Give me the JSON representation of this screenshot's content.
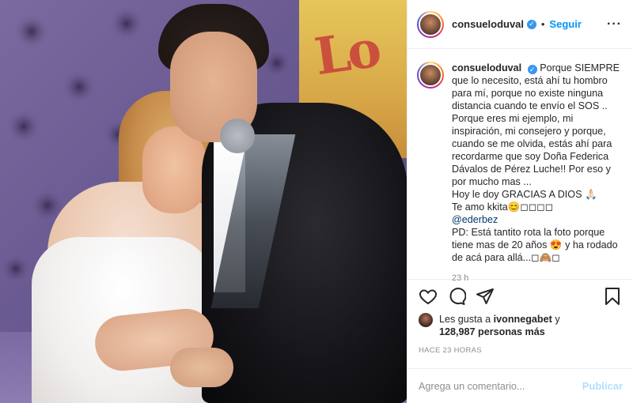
{
  "post": {
    "username": "consueloduval",
    "verified_icon": "verified-badge-icon",
    "follow_label": "Seguir",
    "more_icon": "more-options-icon",
    "caption_lines": [
      "Porque SIEMPRE",
      "que lo necesito, está ahí tu hombro",
      "para mí, porque no existe ninguna",
      "distancia cuando te envío el SOS ..",
      "Porque eres mi ejemplo, mi",
      "inspiración, mi consejero y porque,",
      "cuando se me olvida, estás ahí para",
      "recordarme que soy Doña Federica",
      "Dávalos de Pérez Luche!! Por eso y",
      "por mucho mas ...",
      "Hoy le doy GRACIAS A DIOS 🙏🏻",
      "Te amo kkita😊◻◻◻◻"
    ],
    "mention": "@ederbez",
    "caption_lines_after": [
      "PD: Está tantito rota la foto porque",
      "tiene mas de 20 años 😍 y ha rodado",
      "de acá para allá...◻🙈◻"
    ],
    "time_ago": "23 h",
    "likes_prefix": "Les gusta a",
    "likes_user": "ivonnegabet",
    "likes_conj": "y",
    "likes_count": "128,987 personas más",
    "timestamp": "HACE 23 HORAS",
    "comment_placeholder": "Agrega un comentario...",
    "publish_label": "Publicar",
    "colors": {
      "accent": "#0095f6",
      "publish_disabled": "#b2dffc",
      "muted": "#8e8e8e",
      "text": "#262626"
    },
    "action_icons": [
      "heart-icon",
      "comment-icon",
      "share-icon",
      "bookmark-icon"
    ]
  }
}
